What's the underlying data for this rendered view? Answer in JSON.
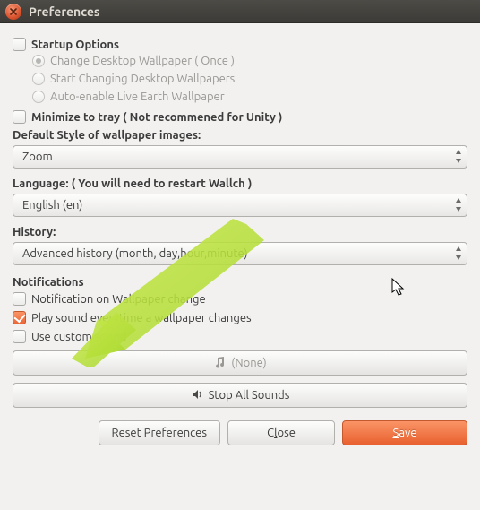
{
  "window": {
    "title": "Preferences"
  },
  "startup": {
    "heading": "Startup Options",
    "opt1": "Change Desktop Wallpaper ( Once )",
    "opt2": "Start Changing Desktop Wallpapers",
    "opt3": "Auto-enable Live Earth Wallpaper"
  },
  "tray": {
    "label": "Minimize to tray ( Not recommened for Unity )"
  },
  "style": {
    "label": "Default Style of wallpaper images:",
    "value": "Zoom"
  },
  "language": {
    "label": "Language: ( You will need to restart Wallch )",
    "value": "English (en)"
  },
  "history": {
    "label": "History:",
    "value": "Advanced history (month, day,hour,minute)"
  },
  "notifications": {
    "heading": "Notifications",
    "onchange": "Notification on Wallpaper change",
    "sound": "Play sound everytime a wallpaper changes",
    "custom": "Use custom sound",
    "file": "(None)",
    "stop": "Stop All Sounds"
  },
  "buttons": {
    "reset": "Reset Preferences",
    "close_pre": "C",
    "close_ul": "l",
    "close_post": "ose",
    "save_pre": "",
    "save_ul": "S",
    "save_post": "ave"
  }
}
